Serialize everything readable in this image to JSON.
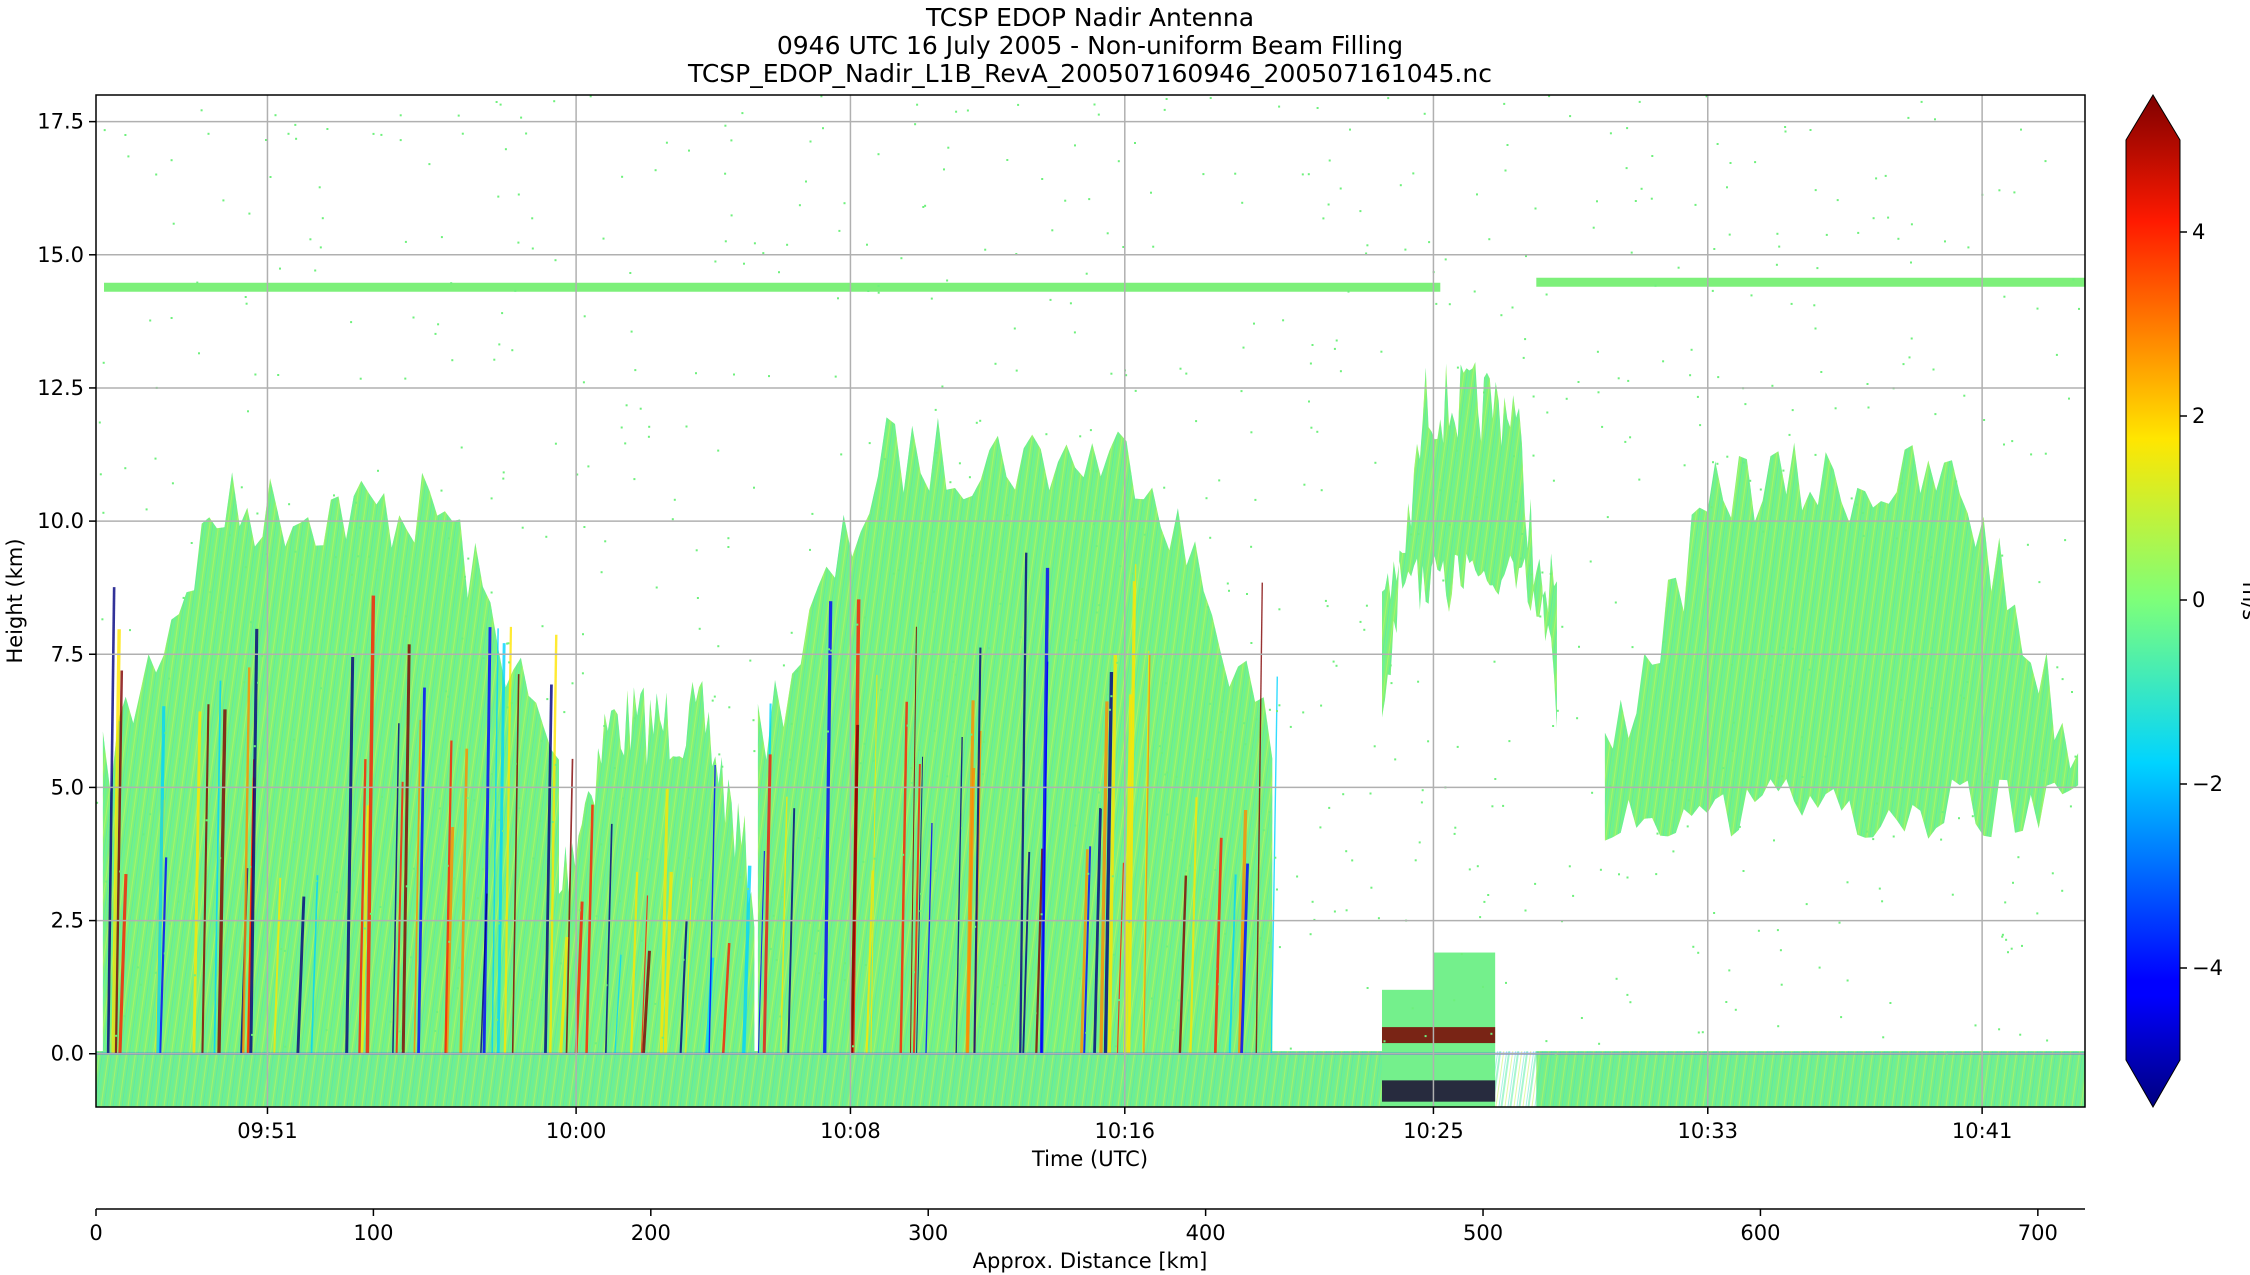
{
  "chart_data": {
    "type": "heatmap",
    "title_lines": [
      "TCSP EDOP Nadir Antenna",
      "0946 UTC 16 July 2005 - Non-uniform Beam Filling",
      "TCSP_EDOP_Nadir_L1B_RevA_200507160946_200507161045.nc"
    ],
    "xlabel": "Time (UTC)",
    "ylabel": "Height (km)",
    "x2label": "Approx. Distance [km]",
    "colorbar_label": "m/s",
    "x_time_ticks": [
      "09:51",
      "10:00",
      "10:08",
      "10:16",
      "10:25",
      "10:33",
      "10:41"
    ],
    "x_time_tick_minutes": [
      5,
      14,
      22,
      30,
      39,
      47,
      55
    ],
    "x_time_range_minutes": [
      0,
      58
    ],
    "y_ticks": [
      0.0,
      2.5,
      5.0,
      7.5,
      10.0,
      12.5,
      15.0,
      17.5
    ],
    "y_tick_labels": [
      "0.0",
      "2.5",
      "5.0",
      "7.5",
      "10.0",
      "12.5",
      "15.0",
      "17.5"
    ],
    "ylim": [
      -1.0,
      18.0
    ],
    "distance_ticks": [
      0,
      100,
      200,
      300,
      400,
      500,
      600,
      700
    ],
    "distance_tick_labels": [
      "0",
      "100",
      "200",
      "300",
      "400",
      "500",
      "600",
      "700"
    ],
    "distance_range": [
      0,
      717
    ],
    "colorbar_ticks": [
      -4,
      -2,
      0,
      2,
      4
    ],
    "colorbar_tick_labels": [
      "−4",
      "−2",
      "0",
      "2",
      "4"
    ],
    "colorbar_range": [
      -5,
      5
    ],
    "colorbar_extend": "both",
    "colormap": "jet",
    "grid": true,
    "surface_height_km": 0.0,
    "plane_altitude_km": 14.4,
    "data_gap_minutes": [
      39.2,
      42.0
    ],
    "echo_regions": [
      {
        "name": "cell-west",
        "t0": 0.2,
        "t1": 13.5,
        "top_km": 11.0
      },
      {
        "name": "cell-mid",
        "t0": 13.5,
        "t1": 19.2,
        "top_km": 7.0
      },
      {
        "name": "cell-central",
        "t0": 19.3,
        "t1": 34.3,
        "top_km": 12.0
      },
      {
        "name": "anvil-east",
        "t0": 37.5,
        "t1": 42.6,
        "top_km": 13.0,
        "base_km": 8.2
      },
      {
        "name": "anvil-far-east",
        "t0": 44.0,
        "t1": 57.8,
        "top_km": 11.5,
        "base_km": 4.0
      }
    ],
    "surface_blocks": [
      {
        "t0": 37.5,
        "t1": 39.0,
        "top_km": 1.2
      },
      {
        "t0": 39.0,
        "t1": 40.8,
        "top_km": 1.9
      }
    ]
  }
}
